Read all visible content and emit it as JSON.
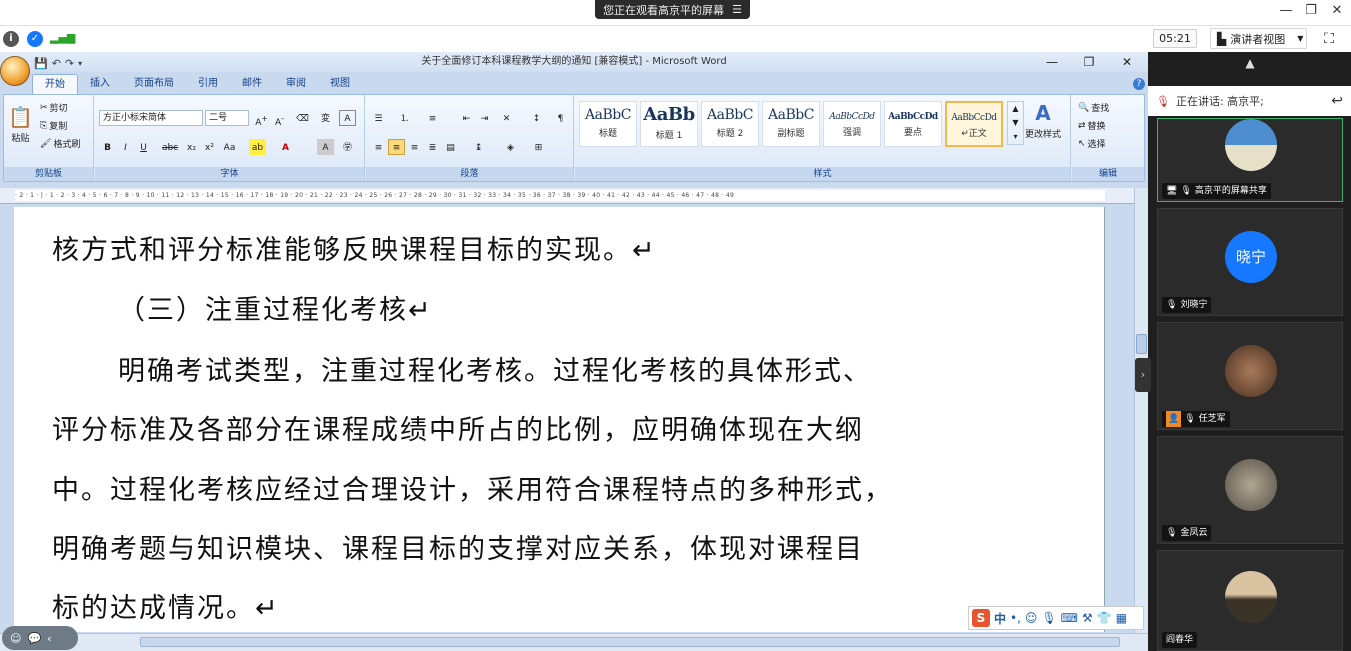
{
  "meeting": {
    "share_banner": "您正在观看高京平的屏幕",
    "share_menu_icon": "menu-icon",
    "timer": "05:21",
    "presenter_view": "演讲者视图",
    "speaking": "正在讲话: 高京平;",
    "tiles": [
      {
        "name": "高京平的屏幕共享",
        "avatar_text": "",
        "color": "#5a8ab5"
      },
      {
        "name": "刘晓宁",
        "avatar_text": "晓宁",
        "color": "#1677ff"
      },
      {
        "name": "任芝军",
        "avatar_text": "",
        "color": "#6a4a3a"
      },
      {
        "name": "金凤云",
        "avatar_text": "",
        "color": "#777766"
      },
      {
        "name": "阎春华",
        "avatar_text": "",
        "color": "#8a7050"
      }
    ]
  },
  "word": {
    "title": "关于全面修订本科课程教学大纲的通知 [兼容模式] - Microsoft Word",
    "tabs": [
      "开始",
      "插入",
      "页面布局",
      "引用",
      "邮件",
      "审阅",
      "视图"
    ],
    "clipboard": {
      "paste": "粘贴",
      "cut": "剪切",
      "copy": "复制",
      "format_painter": "格式刷",
      "label": "剪贴板"
    },
    "font": {
      "name": "方正小标宋简体",
      "size": "二号",
      "label": "字体"
    },
    "paragraph": {
      "label": "段落"
    },
    "styles": {
      "label": "样式",
      "items": [
        {
          "preview": "AaBbC",
          "label": "标题"
        },
        {
          "preview": "AaBb",
          "label": "标题 1"
        },
        {
          "preview": "AaBbC",
          "label": "标题 2"
        },
        {
          "preview": "AaBbC",
          "label": "副标题"
        },
        {
          "preview": "AaBbCcDd",
          "label": "强调"
        },
        {
          "preview": "AaBbCcDd",
          "label": "要点"
        },
        {
          "preview": "AaBbCcDd",
          "label": "↵正文"
        }
      ],
      "change": "更改样式"
    },
    "editing": {
      "find": "查找",
      "replace": "替换",
      "select": "选择",
      "label": "编辑"
    },
    "ruler": "· 2 · 1 · | · 1 · 2 · 3 · 4 · 5 · 6 · 7 · 8 · 9 · 10 · 11 · 12 · 13 · 14 · 15 · 16 · 17 · 18 · 19 · 20 · 21 · 22 · 23 · 24 · 25 · 26 · 27 · 28 · 29 · 30 · 31 · 32 · 33 · 34 · 35 · 36 · 37 · 38 · 39 · 40 · 41 · 42 · 43 · 44 · 45 · 46 · 47 · 48 · 49",
    "lines": [
      "核方式和评分标准能够反映课程目标的实现。↵",
      "（三）注重过程化考核↵",
      "明确考试类型，注重过程化考核。过程化考核的具体形式、",
      "评分标准及各部分在课程成绩中所占的比例，应明确体现在大纲",
      "中。过程化考核应经过合理设计，采用符合课程特点的多种形式，",
      "明确考题与知识模块、课程目标的支撑对应关系，体现对课程目",
      "标的达成情况。↵"
    ],
    "ime_label": "中"
  }
}
